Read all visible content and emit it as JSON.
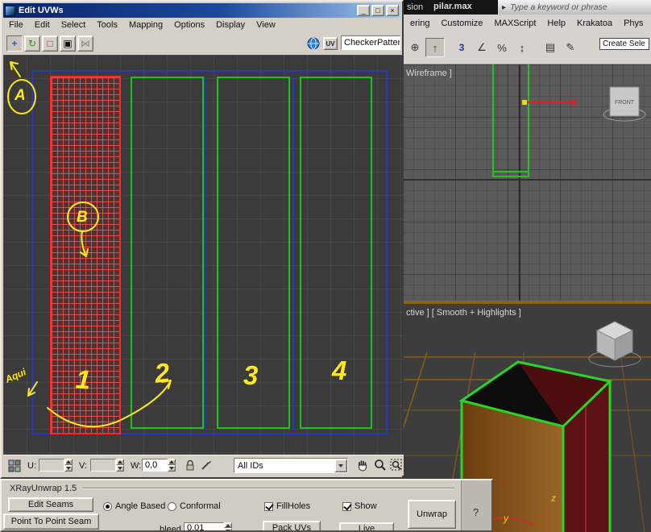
{
  "uvw": {
    "title": "Edit UVWs",
    "window_buttons": {
      "minimize": "_",
      "restore": "□",
      "close": "×"
    },
    "menu": [
      "File",
      "Edit",
      "Select",
      "Tools",
      "Mapping",
      "Options",
      "Display",
      "View"
    ],
    "tool_icons": {
      "move": "+",
      "rotate": "↻",
      "scale": "□",
      "freeform": "▣",
      "mirror": "⋈",
      "uv": "UV"
    },
    "toolbar": {
      "checker": "CheckerPattern"
    },
    "annotations": {
      "a": "A",
      "b": "B",
      "n1": "1",
      "n2": "2",
      "n3": "3",
      "n4": "4",
      "aqui": "Aqui"
    },
    "status": {
      "u_label": "U:",
      "v_label": "V:",
      "w_label": "W:",
      "w_value": "0,0",
      "ids": "All IDs"
    }
  },
  "max": {
    "title_fragment": "sion",
    "file_name": "pilar.max",
    "search_arrow": "▸",
    "search_placeholder": "Type a keyword or phrase",
    "menu": [
      "ering",
      "Customize",
      "MAXScript",
      "Help",
      "Krakatoa",
      "Phys"
    ],
    "toolbar_icons": {
      "manipulate": "⊕",
      "move": "↑",
      "snap3": "3",
      "angle": "∠",
      "percent": "%",
      "spinner": "↕",
      "named_sets": "▤",
      "keyboard": "✎"
    },
    "create_selection": "Create Sele",
    "viewports": {
      "top_label": "Wireframe ]",
      "bottom_label": "ctive ] [ Smooth + Highlights ]",
      "viewcube_front": "FRONT",
      "axis_z": "z",
      "axis_y": "y"
    }
  },
  "xray": {
    "title": "XRayUnwrap 1.5",
    "edit_seams": "Edit Seams",
    "point_to_point": "Point To Point Seam",
    "angle_based": "Angle Based",
    "angle_based_selected": true,
    "conformal": "Conformal",
    "fill_holes": "FillHoles",
    "fill_holes_checked": true,
    "show": "Show",
    "show_checked": true,
    "unwrap": "Unwrap",
    "bleed_label": "bleed",
    "bleed_value": "0.01",
    "pack_uvs": "Pack UVs",
    "live": "Live",
    "help": "?"
  },
  "colors": {
    "annotation": "#ffe91a",
    "island_selected": "#ff2626",
    "island": "#17c517",
    "uv_bounds": "#2836c8",
    "active_viewport": "#8a6410"
  }
}
